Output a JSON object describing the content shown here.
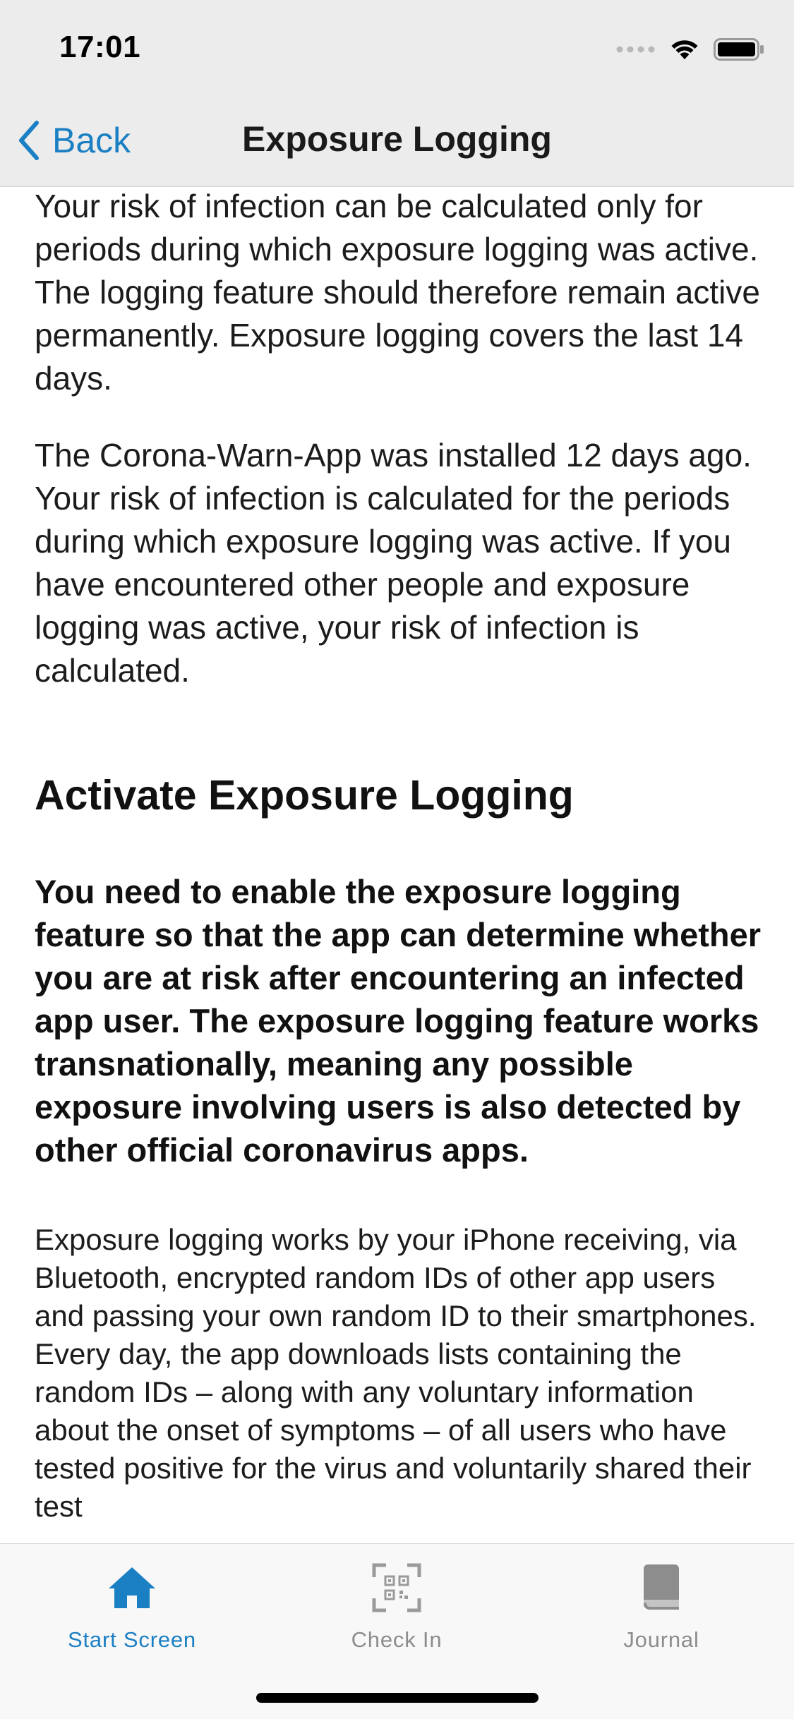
{
  "status_bar": {
    "time": "17:01"
  },
  "nav": {
    "back_label": "Back",
    "title": "Exposure Logging"
  },
  "content": {
    "paragraphs": [
      "Your risk of infection can be calculated only for periods during which exposure logging was active. The logging feature should therefore remain active permanently. Exposure logging covers the last 14 days.",
      "The Corona-Warn-App was installed 12 days ago. Your risk of infection is calculated for the periods during which exposure logging was active. If you have encountered other people and exposure logging was active, your risk of infection is calculated."
    ],
    "section_heading": "Activate Exposure Logging",
    "bold_paragraph": "You need to enable the exposure logging feature so that the app can determine whether you are at risk after encountering an infected app user. The exposure logging feature works transnationally, meaning any possible exposure involving users is also detected by other official coronavirus apps.",
    "body_paragraph": "Exposure logging works by your iPhone receiving, via Bluetooth, encrypted random IDs of other app users and passing your own random ID to their smartphones. Every day, the app downloads lists containing the random IDs – along with any voluntary information about the onset of symptoms – of all users who have tested positive for the virus and voluntarily shared their test"
  },
  "tabbar": {
    "tabs": [
      {
        "label": "Start Screen",
        "icon": "house-icon",
        "active": true
      },
      {
        "label": "Check In",
        "icon": "qr-scan-icon",
        "active": false
      },
      {
        "label": "Journal",
        "icon": "book-icon",
        "active": false
      }
    ]
  },
  "colors": {
    "accent": "#1b7fc3",
    "inactive_tab": "#8d8d8d",
    "header_bg": "#ececec",
    "tabbar_bg": "#f8f8f8"
  }
}
